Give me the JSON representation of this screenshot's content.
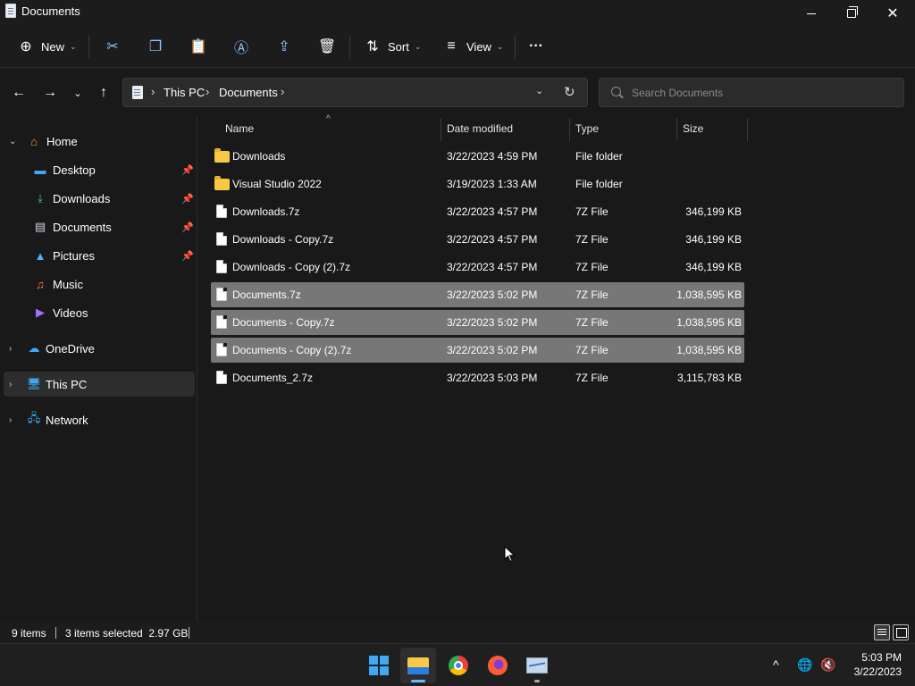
{
  "window": {
    "title": "Documents"
  },
  "commandbar": {
    "new_label": "New",
    "sort_label": "Sort",
    "view_label": "View",
    "more_label": "···"
  },
  "address": {
    "crumbs": [
      "This PC",
      "Documents"
    ]
  },
  "search": {
    "placeholder": "Search Documents"
  },
  "navpane": {
    "items": [
      {
        "label": "Home"
      },
      {
        "label": "Desktop"
      },
      {
        "label": "Downloads"
      },
      {
        "label": "Documents"
      },
      {
        "label": "Pictures"
      },
      {
        "label": "Music"
      },
      {
        "label": "Videos"
      },
      {
        "label": "OneDrive"
      },
      {
        "label": "This PC"
      },
      {
        "label": "Network"
      }
    ]
  },
  "filelist": {
    "columns": {
      "name": "Name",
      "date": "Date modified",
      "type": "Type",
      "size": "Size"
    },
    "rows": [
      {
        "name": "Downloads",
        "date": "3/22/2023 4:59 PM",
        "type": "File folder",
        "size": "",
        "kind": "folder",
        "selected": false
      },
      {
        "name": "Visual Studio 2022",
        "date": "3/19/2023 1:33 AM",
        "type": "File folder",
        "size": "",
        "kind": "folder",
        "selected": false
      },
      {
        "name": "Downloads.7z",
        "date": "3/22/2023 4:57 PM",
        "type": "7Z File",
        "size": "346,199 KB",
        "kind": "file",
        "selected": false
      },
      {
        "name": "Downloads - Copy.7z",
        "date": "3/22/2023 4:57 PM",
        "type": "7Z File",
        "size": "346,199 KB",
        "kind": "file",
        "selected": false
      },
      {
        "name": "Downloads - Copy (2).7z",
        "date": "3/22/2023 4:57 PM",
        "type": "7Z File",
        "size": "346,199 KB",
        "kind": "file",
        "selected": false
      },
      {
        "name": "Documents.7z",
        "date": "3/22/2023 5:02 PM",
        "type": "7Z File",
        "size": "1,038,595 KB",
        "kind": "file",
        "selected": true
      },
      {
        "name": "Documents - Copy.7z",
        "date": "3/22/2023 5:02 PM",
        "type": "7Z File",
        "size": "1,038,595 KB",
        "kind": "file",
        "selected": true
      },
      {
        "name": "Documents - Copy (2).7z",
        "date": "3/22/2023 5:02 PM",
        "type": "7Z File",
        "size": "1,038,595 KB",
        "kind": "file",
        "selected": true
      },
      {
        "name": "Documents_2.7z",
        "date": "3/22/2023 5:03 PM",
        "type": "7Z File",
        "size": "3,115,783 KB",
        "kind": "file",
        "selected": false
      }
    ]
  },
  "statusbar": {
    "item_count": "9 items",
    "selection": "3 items selected  2.97 GB"
  },
  "taskbar": {
    "apps": [
      "start-icon",
      "file-explorer-icon",
      "chrome-icon",
      "firefox-icon",
      "resource-monitor-icon"
    ],
    "time": "5:03 PM",
    "date": "3/22/2023"
  },
  "colors": {
    "background": "#191919",
    "selected_row": "#777777",
    "accent": "#6cb8ff",
    "folder": "#f8c945"
  }
}
